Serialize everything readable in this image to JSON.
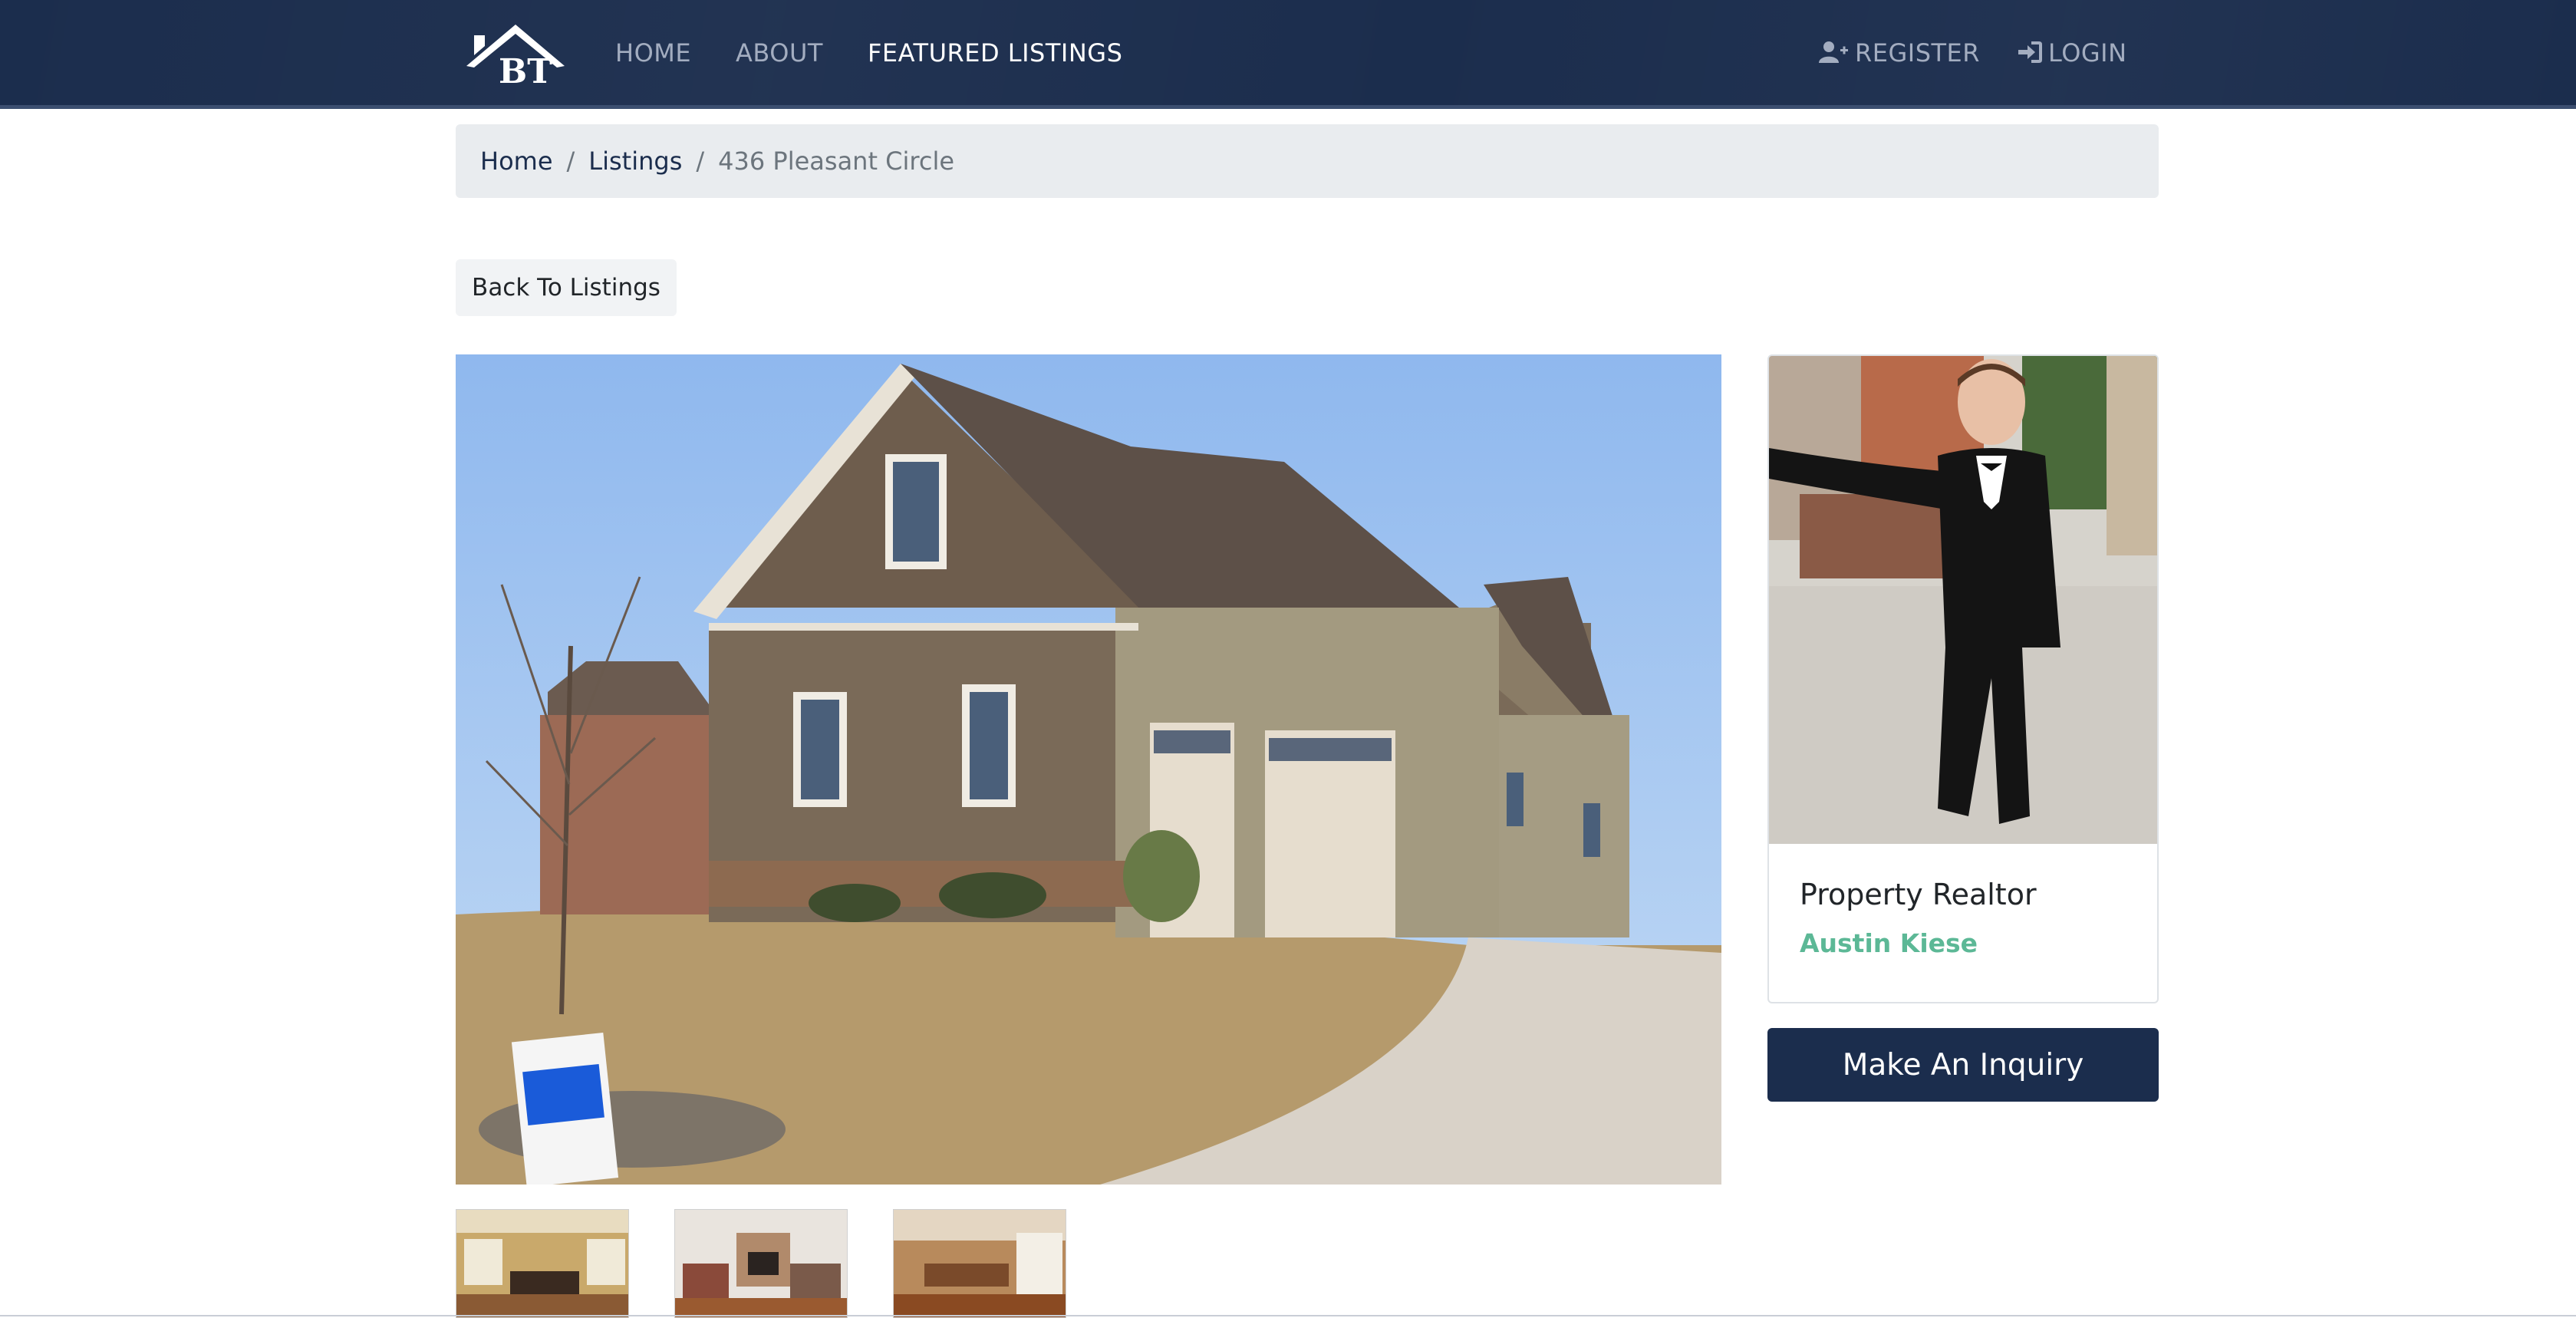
{
  "navbar": {
    "logo_text": "BT",
    "links": [
      {
        "label": "HOME",
        "active": false
      },
      {
        "label": "ABOUT",
        "active": false
      },
      {
        "label": "FEATURED LISTINGS",
        "active": true
      }
    ],
    "register_label": "REGISTER",
    "login_label": "LOGIN",
    "register_icon": "user-plus-icon",
    "login_icon": "sign-in-icon"
  },
  "breadcrumb": {
    "items": [
      "Home",
      "Listings"
    ],
    "separator": "/",
    "current": "436 Pleasant Circle"
  },
  "back_button": {
    "label": "Back To Listings"
  },
  "listing": {
    "main_image": "house-photo",
    "thumbnails": [
      "billiard-room-photo",
      "living-room-photo",
      "kitchen-photo"
    ]
  },
  "realtor": {
    "title": "Property Realtor",
    "name": "Austin Kiese",
    "photo": "realtor-photo"
  },
  "inquiry_button": {
    "label": "Make An Inquiry"
  },
  "colors": {
    "navbar": "#1b2d4d",
    "accent_green": "#5cb896",
    "breadcrumb_bg": "#e9ecef",
    "button_dark": "#1b2d4d"
  }
}
